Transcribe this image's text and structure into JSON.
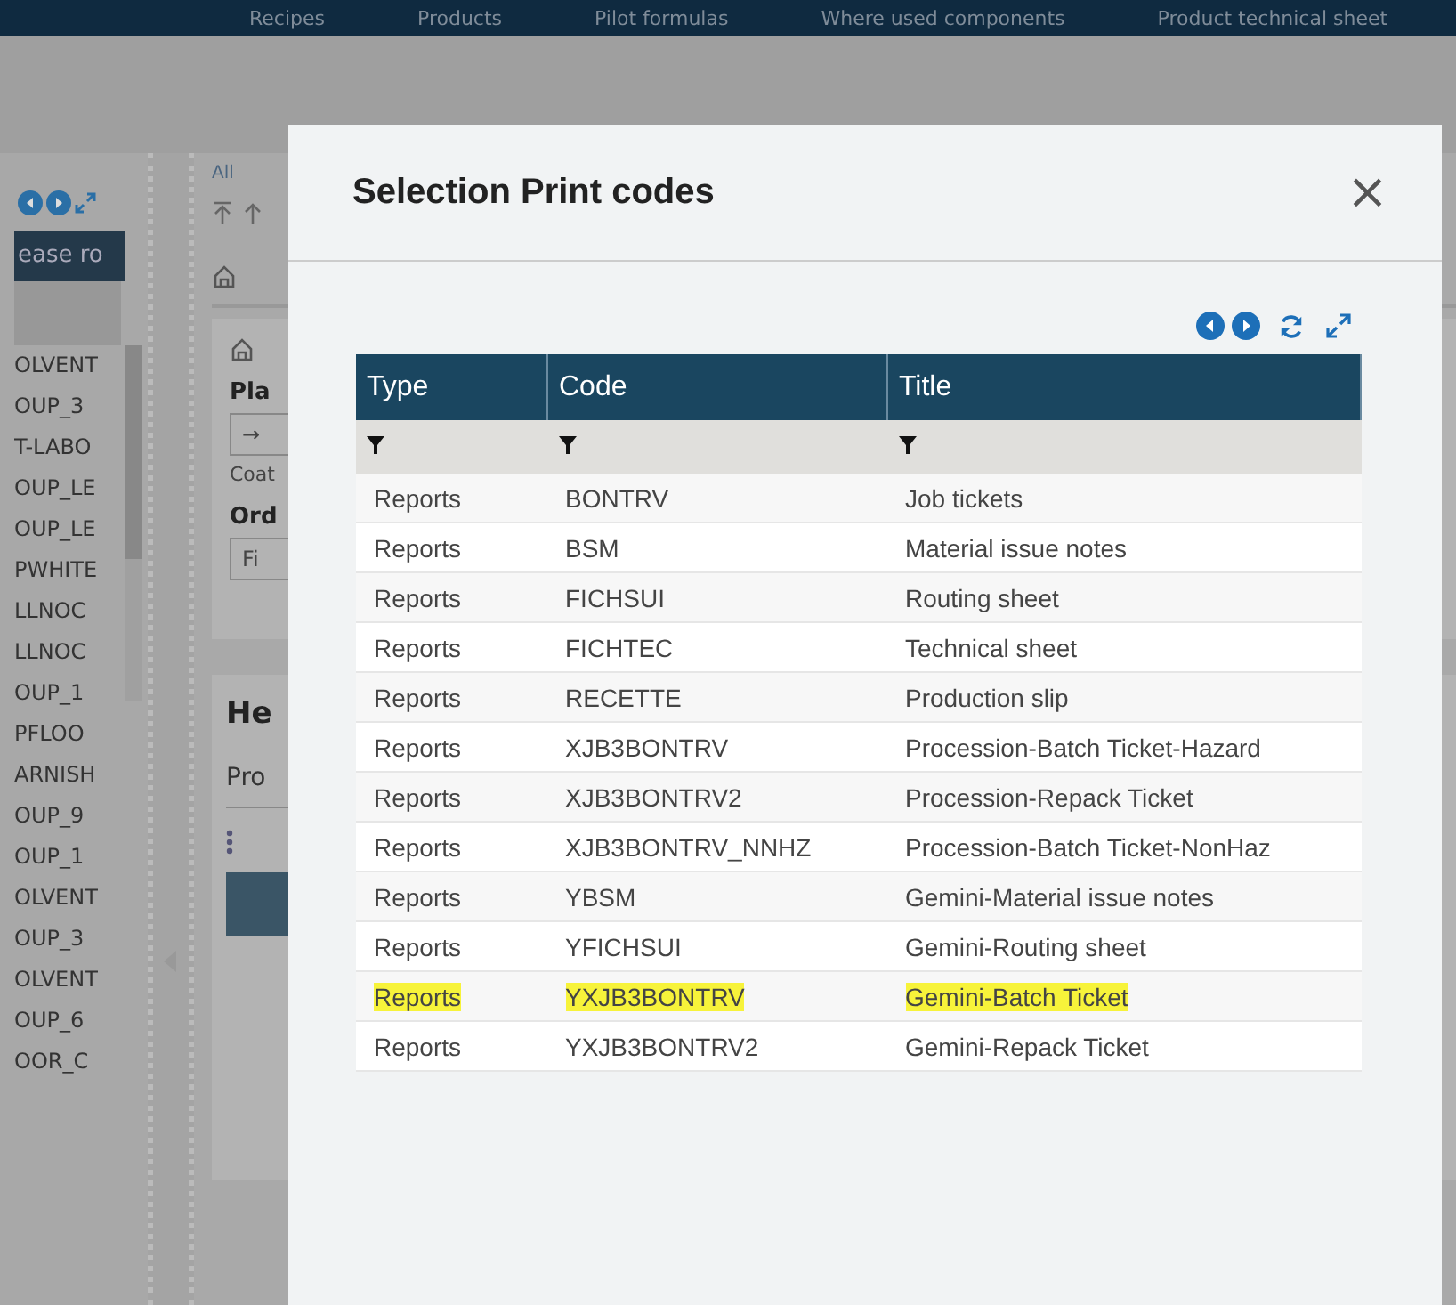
{
  "top_nav": {
    "items": [
      "Recipes",
      "Products",
      "Pilot formulas",
      "Where used components",
      "Product technical sheet"
    ]
  },
  "left_panel": {
    "button": "ease ro",
    "items": [
      "OLVENT",
      "OUP_3",
      "T-LABO",
      "OUP_LE",
      "OUP_LE",
      "PWHITE",
      "LLNOC",
      "LLNOC",
      "OUP_1",
      "PFLOO",
      "ARNISH",
      "OUP_9",
      "OUP_1",
      "OLVENT",
      "OUP_3",
      "OLVENT",
      "OUP_6",
      "OOR_C"
    ]
  },
  "background": {
    "breadcrumb": "All",
    "section_1": "Pla",
    "field_1": "→",
    "caption_1": "Coat",
    "section_2": "Ord",
    "field_2": "Fi",
    "heading": "He",
    "tab": "Pro"
  },
  "dialog": {
    "title": "Selection Print codes",
    "close": "×",
    "table": {
      "columns": [
        "Type",
        "Code",
        "Title"
      ],
      "rows": [
        {
          "cells": [
            "Reports",
            "BONTRV",
            "Job tickets"
          ],
          "highlighted": false
        },
        {
          "cells": [
            "Reports",
            "BSM",
            "Material issue notes"
          ],
          "highlighted": false
        },
        {
          "cells": [
            "Reports",
            "FICHSUI",
            "Routing sheet"
          ],
          "highlighted": false
        },
        {
          "cells": [
            "Reports",
            "FICHTEC",
            "Technical sheet"
          ],
          "highlighted": false
        },
        {
          "cells": [
            "Reports",
            "RECETTE",
            "Production slip"
          ],
          "highlighted": false
        },
        {
          "cells": [
            "Reports",
            "XJB3BONTRV",
            "Procession-Batch Ticket-Hazard"
          ],
          "highlighted": false
        },
        {
          "cells": [
            "Reports",
            "XJB3BONTRV2",
            "Procession-Repack Ticket"
          ],
          "highlighted": false
        },
        {
          "cells": [
            "Reports",
            "XJB3BONTRV_NNHZ",
            "Procession-Batch Ticket-NonHaz"
          ],
          "highlighted": false
        },
        {
          "cells": [
            "Reports",
            "YBSM",
            "Gemini-Material issue notes"
          ],
          "highlighted": false
        },
        {
          "cells": [
            "Reports",
            "YFICHSUI",
            "Gemini-Routing sheet"
          ],
          "highlighted": false
        },
        {
          "cells": [
            "Reports",
            "YXJB3BONTRV",
            "Gemini-Batch Ticket"
          ],
          "highlighted": true
        },
        {
          "cells": [
            "Reports",
            "YXJB3BONTRV2",
            "Gemini-Repack Ticket"
          ],
          "highlighted": false
        }
      ]
    }
  }
}
